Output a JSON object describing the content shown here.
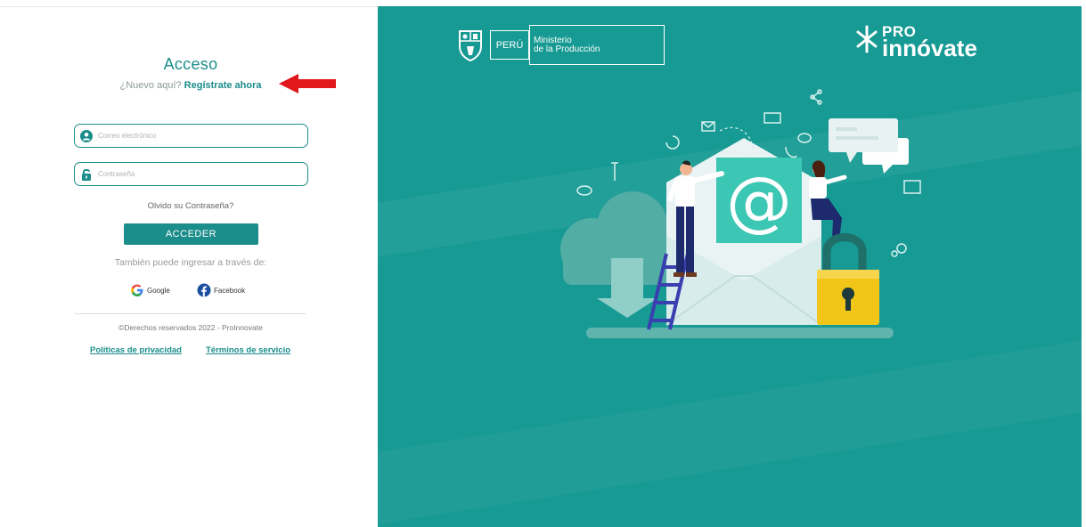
{
  "login": {
    "title": "Acceso",
    "new_here": "¿Nuevo aquí?",
    "register_link": "Regístrate ahora",
    "email_placeholder": "Correo electrónico",
    "password_placeholder": "Contraseña",
    "forgot": "Olvido su Contraseña?",
    "submit_label": "ACCEDER",
    "also_via": "También puede ingresar a través de:",
    "google_label": "Google",
    "facebook_label": "Facebook",
    "copyright": "©Derechos reservados 2022 - ProInnovate",
    "privacy_link": "Políticas de privacidad",
    "terms_link": "Términos de servicio"
  },
  "branding": {
    "peru": "PERÚ",
    "ministry_line1": "Ministerio",
    "ministry_line2": "de la Producción",
    "pro": "PRO",
    "innovate": "innóvate"
  },
  "colors": {
    "accent": "#1b8d8a",
    "panel": "#179a93",
    "arrow": "#e0171b"
  },
  "icons": [
    "user-icon",
    "lock-icon",
    "google-icon",
    "facebook-icon",
    "red-arrow-icon",
    "peru-crest-icon",
    "proinnovate-logo-icon"
  ]
}
